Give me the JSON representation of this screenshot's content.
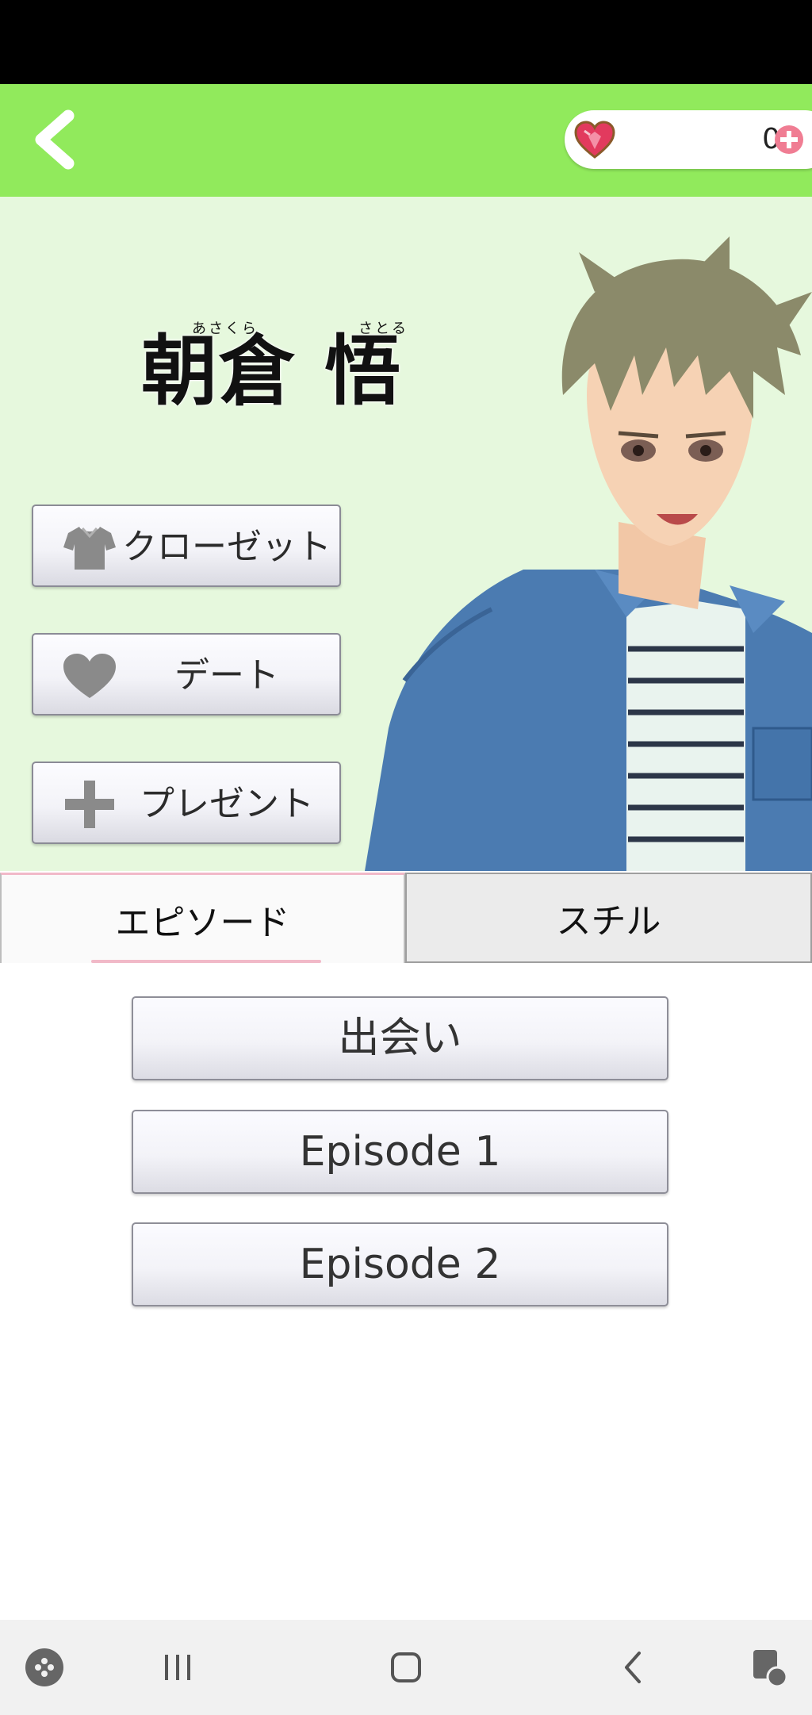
{
  "header": {
    "gem_count": "0"
  },
  "character": {
    "name": "朝倉 悟",
    "family_name_reading": "あさくら",
    "given_name_reading": "さとる"
  },
  "actions": [
    {
      "label": "クローゼット",
      "icon": "shirt-icon"
    },
    {
      "label": "デート",
      "icon": "heart-icon"
    },
    {
      "label": "プレゼント",
      "icon": "plus-icon"
    }
  ],
  "tabs": [
    {
      "label": "エピソード",
      "selected": true
    },
    {
      "label": "スチル",
      "selected": false
    }
  ],
  "episodes": [
    "出会い",
    "Episode 1",
    "Episode 2"
  ],
  "colors": {
    "header": "#91ea5c",
    "profile_bg": "#e6f8dd",
    "tab_accent": "#f1b9c8",
    "gem": "#e23a5e"
  },
  "nav_icons": [
    "game-tools-icon",
    "recent-apps-icon",
    "home-icon",
    "back-icon",
    "assistant-icon"
  ]
}
